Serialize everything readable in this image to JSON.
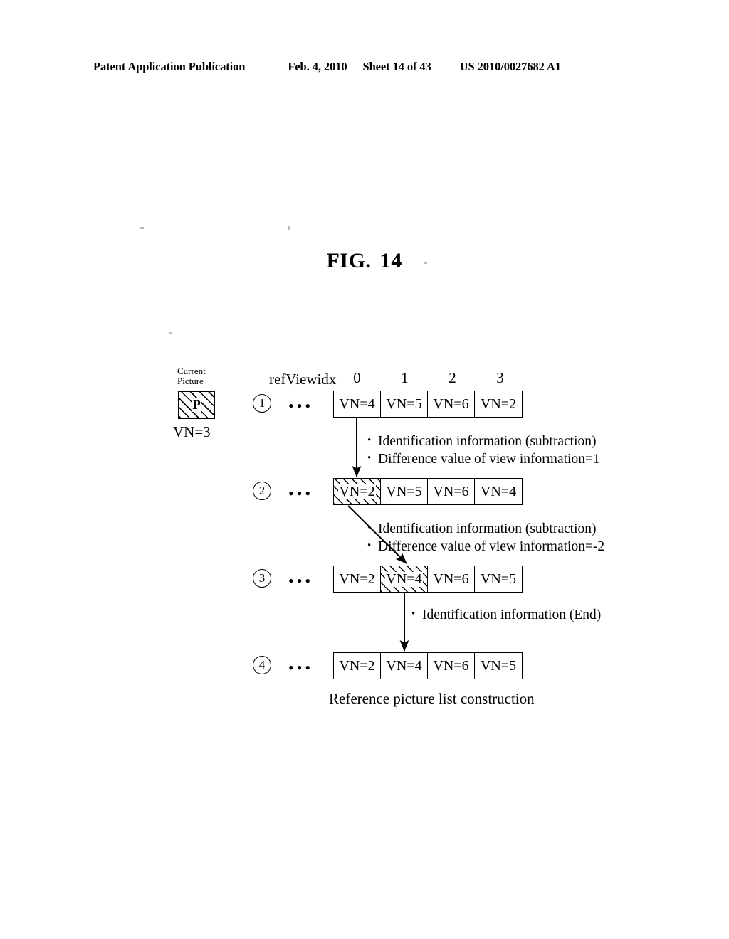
{
  "header": {
    "publication": "Patent Application Publication",
    "date": "Feb. 4, 2010",
    "sheet": "Sheet 14 of 43",
    "patent_number": "US 2010/0027682 A1"
  },
  "figure": {
    "label": "FIG.",
    "number": "14",
    "caption": "Reference picture list construction"
  },
  "current_picture": {
    "label_line1": "Current",
    "label_line2": "Picture",
    "box_text": "P",
    "view_number": "VN=3"
  },
  "table_header": {
    "axis_label": "refViewidx",
    "indices": [
      "0",
      "1",
      "2",
      "3"
    ]
  },
  "rows": [
    {
      "marker": "1",
      "ellipsis": "•••",
      "cells": [
        {
          "text": "VN=4",
          "hatched": false
        },
        {
          "text": "VN=5",
          "hatched": false
        },
        {
          "text": "VN=6",
          "hatched": false
        },
        {
          "text": "VN=2",
          "hatched": false
        }
      ]
    },
    {
      "marker": "2",
      "ellipsis": "•••",
      "cells": [
        {
          "text": "VN=2",
          "hatched": true
        },
        {
          "text": "VN=5",
          "hatched": false
        },
        {
          "text": "VN=6",
          "hatched": false
        },
        {
          "text": "VN=4",
          "hatched": false
        }
      ]
    },
    {
      "marker": "3",
      "ellipsis": "•••",
      "cells": [
        {
          "text": "VN=2",
          "hatched": false
        },
        {
          "text": "VN=4",
          "hatched": true
        },
        {
          "text": "VN=6",
          "hatched": false
        },
        {
          "text": "VN=5",
          "hatched": false
        }
      ]
    },
    {
      "marker": "4",
      "ellipsis": "•••",
      "cells": [
        {
          "text": "VN=2",
          "hatched": false
        },
        {
          "text": "VN=4",
          "hatched": false
        },
        {
          "text": "VN=6",
          "hatched": false
        },
        {
          "text": "VN=5",
          "hatched": false
        }
      ]
    }
  ],
  "notes": [
    {
      "line1": "Identification information (subtraction)",
      "line2": "Difference value of view information=1"
    },
    {
      "line1": "Identification information (subtraction)",
      "line2": "Difference value of view information=-2"
    },
    {
      "line1": "Identification information (End)",
      "line2": ""
    }
  ]
}
